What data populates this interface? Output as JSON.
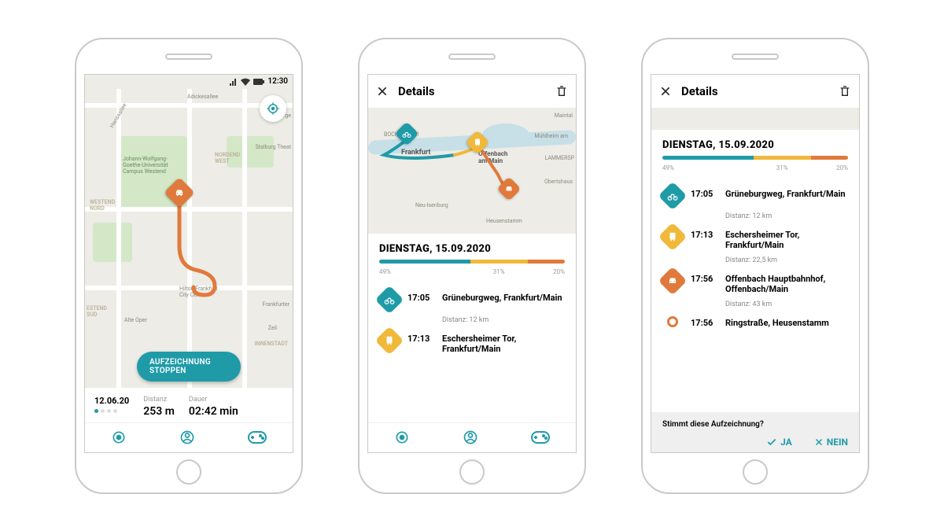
{
  "colors": {
    "teal": "#1f9ba8",
    "yellow": "#f0b93a",
    "orange": "#e07a3c"
  },
  "phone1": {
    "status_time": "12:30",
    "map_labels": {
      "adickes": "Adickesallee",
      "hansa": "Hansaallee",
      "uni": "Johann-Wolfgang-\nGoethe-Universität\nCampus Westend",
      "nordend": "NORDEND\nWEST",
      "westend": "WESTEND\nNORD",
      "stalburg": "Stalburg Theat",
      "burge": "Bürge",
      "miquel": "",
      "hilton": "Hilton Frankfurt\nCity Centre",
      "oper": "Alte Oper",
      "frankfurter": "Frankfurter",
      "zeil": "Zeil",
      "westend_sud": "ESTEND\nSUD",
      "innenstadt": "INNENSTADT"
    },
    "stop_button": "AUFZEICHNUNG STOPPEN",
    "stats": {
      "date": "12.06.20",
      "dist_label": "Distanz",
      "dist_value": "253 m",
      "dur_label": "Dauer",
      "dur_value": "02:42 min"
    }
  },
  "phone2": {
    "title": "Details",
    "day": "DIENSTAG, 15.09.2020",
    "segments": {
      "s1": "49%",
      "s2": "31%",
      "s3": "20%"
    },
    "map_labels": {
      "frankfurt": "Frankfurt",
      "offenbach": "Offenbach\nam Main",
      "maintal": "Maintal",
      "bockenheim": "BOCKENHEIM",
      "neuisenburg": "Neu-Isenburg",
      "muhlheim": "Mühlheim am",
      "obertshaus": "Obertshaus",
      "heusen": "Heusenstamm",
      "lammersp": "LAMMERSP"
    },
    "rows": [
      {
        "icon": "bike",
        "color": "teal",
        "time": "17:05",
        "place": "Grüneburgweg, Frankfurt/Main",
        "dist": "Distanz: 12 km"
      },
      {
        "icon": "train",
        "color": "yellow",
        "time": "17:13",
        "place": "Eschersheimer Tor, Frankfurt/Main"
      }
    ]
  },
  "phone3": {
    "title": "Details",
    "day": "DIENSTAG, 15.09.2020",
    "segments": {
      "s1": "49%",
      "s2": "31%",
      "s3": "20%"
    },
    "rows": [
      {
        "icon": "bike",
        "color": "teal",
        "time": "17:05",
        "place": "Grüneburgweg, Frankfurt/Main",
        "dist": "Distanz: 12 km"
      },
      {
        "icon": "train",
        "color": "yellow",
        "time": "17:13",
        "place": "Eschersheimer Tor, Frankfurt/Main",
        "dist": "Distanz: 22,5 km"
      },
      {
        "icon": "car",
        "color": "orange",
        "time": "17:56",
        "place": "Offenbach Hauptbahnhof, Offenbach/Main",
        "dist": "Distanz: 43 km"
      },
      {
        "icon": "dot",
        "color": "orange",
        "time": "17:56",
        "place": "Ringstraße, Heusenstamm"
      }
    ],
    "confirm_q": "Stimmt diese Aufzeichnung?",
    "yes": "JA",
    "no": "NEIN"
  }
}
